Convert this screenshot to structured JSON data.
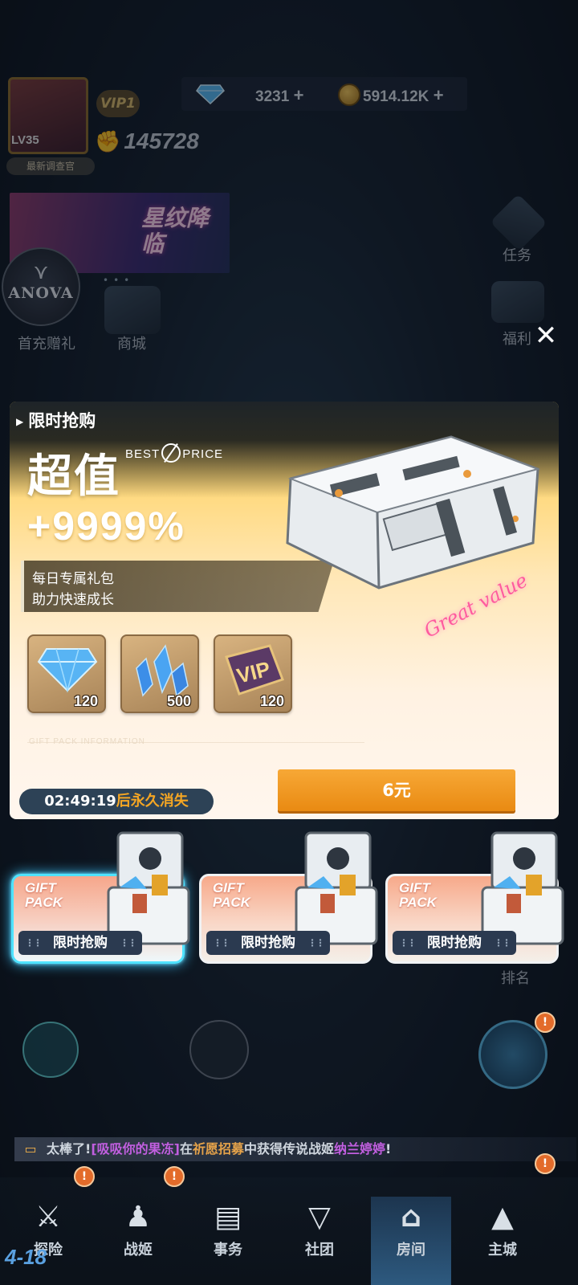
{
  "header": {
    "level": "LV35",
    "nickname": "最新调查官",
    "vip": "VIP1",
    "power": "145728",
    "gems": "3231",
    "coins": "5914.12K"
  },
  "banner": {
    "title": "星纹降临"
  },
  "logo": {
    "text": "ANOVA"
  },
  "side_left": [
    {
      "label": "首充赠礼"
    },
    {
      "label": "商城"
    }
  ],
  "side_right": [
    {
      "label": "任务"
    },
    {
      "label": "福利"
    },
    {
      "label": "排名"
    }
  ],
  "popup": {
    "section_title": "限时抢购",
    "headline": "超值",
    "best_price": "BEST PRICE",
    "bonus": "+9999%",
    "desc_line1": "每日专属礼包",
    "desc_line2": "助力快速成长",
    "great_value": "Great value",
    "items": [
      {
        "icon": "diamond-icon",
        "qty": "120"
      },
      {
        "icon": "crystal-shards-icon",
        "qty": "500"
      },
      {
        "icon": "vip-ticket-icon",
        "qty": "120"
      }
    ],
    "info_label": "GIFT PACK INFORMATION",
    "timer_value": "02:49:19",
    "timer_suffix": "后永久消失",
    "price": "6元"
  },
  "packs": [
    {
      "tag_line1": "GIFT",
      "tag_line2": "PACK",
      "label": "限时抢购",
      "active": true
    },
    {
      "tag_line1": "GIFT",
      "tag_line2": "PACK",
      "label": "限时抢购",
      "active": false
    },
    {
      "tag_line1": "GIFT",
      "tag_line2": "PACK",
      "label": "限时抢购",
      "active": false
    }
  ],
  "ticker": {
    "prefix": "太棒了!",
    "player": "[吸吸你的果冻]",
    "mid1": "在",
    "event": "祈愿招募",
    "mid2": "中获得传说战姬",
    "unit": "纳兰婷婷",
    "suffix": "!"
  },
  "nav": [
    {
      "label": "探险",
      "icon": "crossed-swords-icon"
    },
    {
      "label": "战姬",
      "icon": "team-icon"
    },
    {
      "label": "事务",
      "icon": "book-icon"
    },
    {
      "label": "社团",
      "icon": "emblem-icon"
    },
    {
      "label": "房间",
      "icon": "house-icon"
    },
    {
      "label": "主城",
      "icon": "city-icon"
    }
  ],
  "stage": "4-18",
  "badge_mark": "!",
  "colors": {
    "accent": "#f5a623",
    "buy": "#ee9015",
    "active_glow": "#3dc8ff"
  }
}
